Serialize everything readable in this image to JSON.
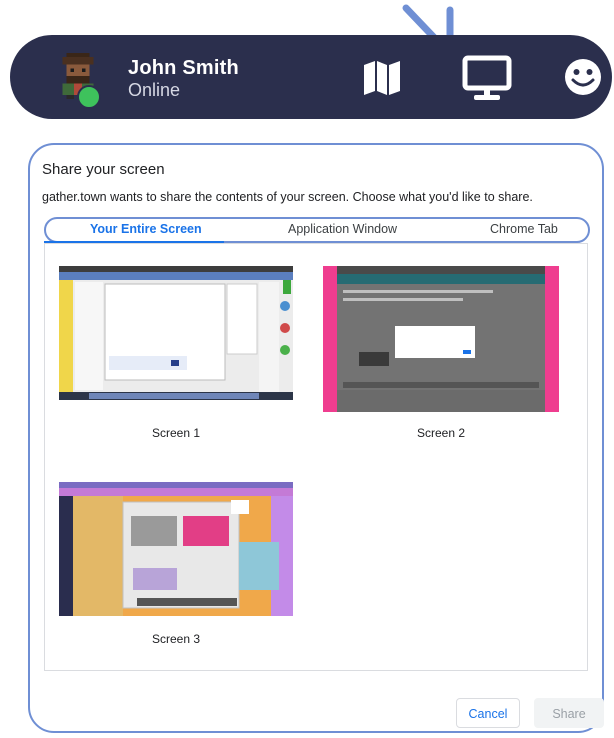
{
  "profile": {
    "name": "John Smith",
    "status": "Online",
    "status_color": "#3ec25c",
    "bar_color": "#2b2f4d",
    "icons": [
      "map-icon",
      "screen-share-icon",
      "smile-icon"
    ]
  },
  "dialog": {
    "title": "Share your screen",
    "description": "gather.town wants to share the contents of your screen. Choose what you'd like to share.",
    "tabs": [
      {
        "label": "Your Entire Screen",
        "active": true
      },
      {
        "label": "Application Window",
        "active": false
      },
      {
        "label": "Chrome Tab",
        "active": false
      }
    ],
    "screens": [
      {
        "label": "Screen 1"
      },
      {
        "label": "Screen 2"
      },
      {
        "label": "Screen 3"
      }
    ],
    "cancel_label": "Cancel",
    "share_label": "Share"
  },
  "colors": {
    "accent": "#1a73e8",
    "annotation": "#6f8fd4"
  }
}
